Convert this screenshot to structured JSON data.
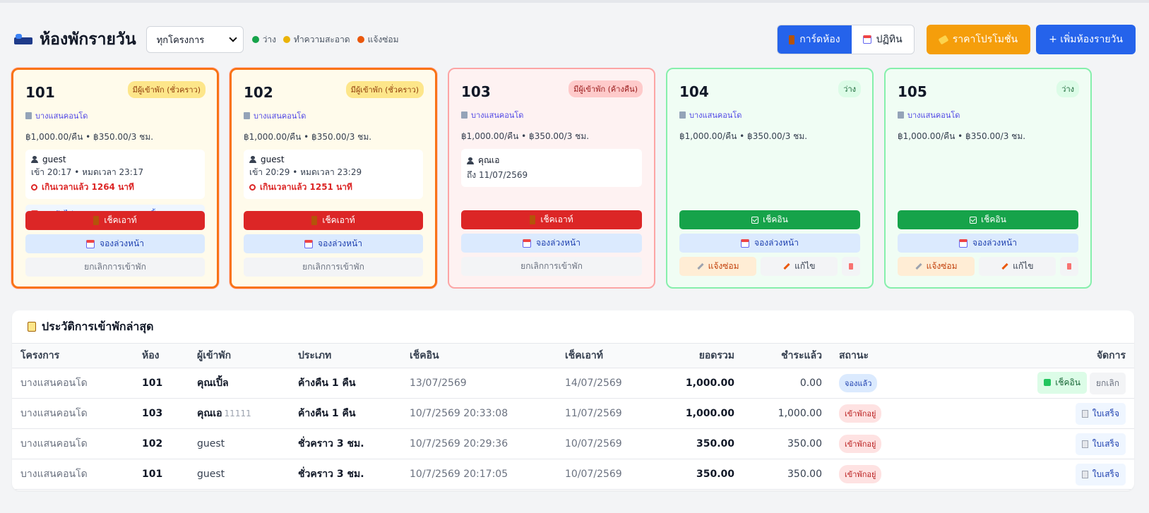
{
  "header": {
    "title": "ห้องพักรายวัน",
    "project_filter": "ทุกโครงการ",
    "legend": [
      {
        "label": "ว่าง",
        "color": "#16a34a"
      },
      {
        "label": "ทำความสะอาด",
        "color": "#eab308"
      },
      {
        "label": "แจ้งซ่อม",
        "color": "#ea580c"
      }
    ],
    "view_card": "การ์ดห้อง",
    "view_calendar": "ปฏิทิน",
    "promo_button": "ราคาโปรโมชั่น",
    "add_button": "+ เพิ่มห้องรายวัน"
  },
  "rooms": [
    {
      "number": "101",
      "status": "มีผู้เข้าพัก (ชั่วคราว)",
      "project": "บางแสนคอนโด",
      "price": "฿1,000.00/คืน • ฿350.00/3 ชม.",
      "guest": "guest",
      "times": "เข้า 20:17 • หมดเวลา 23:17",
      "overdue": "เกินเวลาแล้ว 1264 นาที",
      "next_booking": "จองถัดไป: 13/07/2569 — คุณเปิ้ล",
      "checkout": "เช็คเอาท์",
      "book": "จองล่วงหน้า",
      "cancel": "ยกเลิกการเข้าพัก"
    },
    {
      "number": "102",
      "status": "มีผู้เข้าพัก (ชั่วคราว)",
      "project": "บางแสนคอนโด",
      "price": "฿1,000.00/คืน • ฿350.00/3 ชม.",
      "guest": "guest",
      "times": "เข้า 20:29 • หมดเวลา 23:29",
      "overdue": "เกินเวลาแล้ว 1251 นาที",
      "checkout": "เช็คเอาท์",
      "book": "จองล่วงหน้า",
      "cancel": "ยกเลิกการเข้าพัก"
    },
    {
      "number": "103",
      "status": "มีผู้เข้าพัก (ค้างคืน)",
      "project": "บางแสนคอนโด",
      "price": "฿1,000.00/คืน • ฿350.00/3 ชม.",
      "guest": "คุณเอ",
      "times": "ถึง 11/07/2569",
      "checkout": "เช็คเอาท์",
      "book": "จองล่วงหน้า",
      "cancel": "ยกเลิกการเข้าพัก"
    },
    {
      "number": "104",
      "status": "ว่าง",
      "project": "บางแสนคอนโด",
      "price": "฿1,000.00/คืน • ฿350.00/3 ชม.",
      "checkin": "เช็คอิน",
      "book": "จองล่วงหน้า",
      "repair": "แจ้งซ่อม",
      "edit": "แก้ไข"
    },
    {
      "number": "105",
      "status": "ว่าง",
      "project": "บางแสนคอนโด",
      "price": "฿1,000.00/คืน • ฿350.00/3 ชม.",
      "checkin": "เช็คอิน",
      "book": "จองล่วงหน้า",
      "repair": "แจ้งซ่อม",
      "edit": "แก้ไข"
    }
  ],
  "history": {
    "title": "ประวัติการเข้าพักล่าสุด",
    "columns": [
      "โครงการ",
      "ห้อง",
      "ผู้เข้าพัก",
      "ประเภท",
      "เช็คอิน",
      "เช็คเอาท์",
      "ยอดรวม",
      "ชำระแล้ว",
      "สถานะ",
      "จัดการ"
    ],
    "rows": [
      {
        "project": "บางแสนคอนโด",
        "room": "101",
        "guest": "คุณเปิ้ล",
        "guest_sub": "",
        "type": "ค้างคืน 1 คืน",
        "checkin": "13/07/2569",
        "checkout": "14/07/2569",
        "total": "1,000.00",
        "paid": "0.00",
        "status": "จองแล้ว",
        "action1": "เช็คอิน",
        "action2": "ยกเลิก"
      },
      {
        "project": "บางแสนคอนโด",
        "room": "103",
        "guest": "คุณเอ",
        "guest_sub": "11111",
        "type": "ค้างคืน 1 คืน",
        "checkin": "10/7/2569 20:33:08",
        "checkout": "11/07/2569",
        "total": "1,000.00",
        "paid": "1,000.00",
        "status": "เข้าพักอยู่",
        "action1": "ใบเสร็จ"
      },
      {
        "project": "บางแสนคอนโด",
        "room": "102",
        "guest": "guest",
        "guest_sub": "",
        "type": "ชั่วคราว 3 ชม.",
        "checkin": "10/7/2569 20:29:36",
        "checkout": "10/07/2569",
        "total": "350.00",
        "paid": "350.00",
        "status": "เข้าพักอยู่",
        "action1": "ใบเสร็จ"
      },
      {
        "project": "บางแสนคอนโด",
        "room": "101",
        "guest": "guest",
        "guest_sub": "",
        "type": "ชั่วคราว 3 ชม.",
        "checkin": "10/7/2569 20:17:05",
        "checkout": "10/07/2569",
        "total": "350.00",
        "paid": "350.00",
        "status": "เข้าพักอยู่",
        "action1": "ใบเสร็จ"
      }
    ]
  }
}
